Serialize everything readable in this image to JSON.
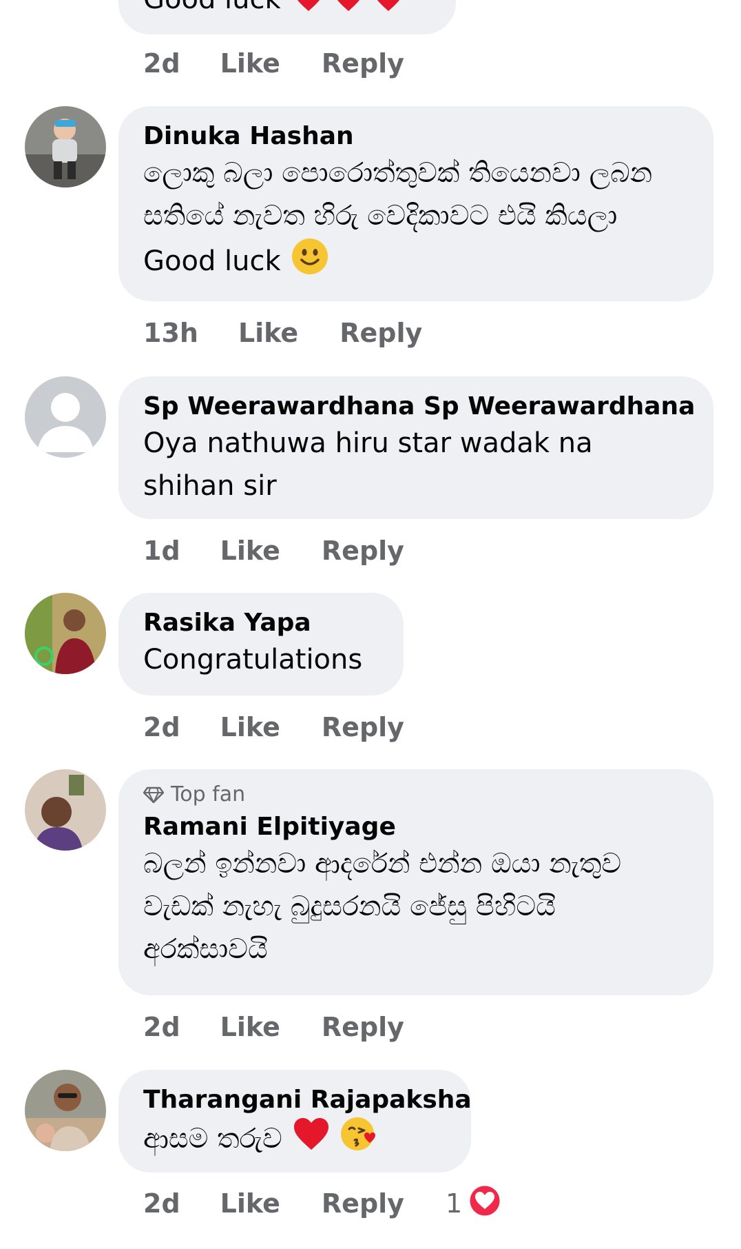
{
  "partial_comment": {
    "text": "Good luck",
    "time": "2d",
    "like_label": "Like",
    "reply_label": "Reply"
  },
  "comments": [
    {
      "author": "Dinuka Hashan",
      "text": "ලොකු බලා පොරොත්තුවක් තියෙනවා ලබන සතියේ නැවත හිරු වෙදිකාවට එයි කියලා Good luck",
      "time": "13h",
      "like_label": "Like",
      "reply_label": "Reply",
      "emoji": "slightly-smiling-face-icon"
    },
    {
      "author": "Sp Weerawardhana Sp Weerawardhana",
      "text": "Oya nathuwa hiru star wadak na shihan sir",
      "time": "1d",
      "like_label": "Like",
      "reply_label": "Reply"
    },
    {
      "author": "Rasika Yapa",
      "text": "Congratulations",
      "time": "2d",
      "like_label": "Like",
      "reply_label": "Reply"
    },
    {
      "badge": "Top fan",
      "author": "Ramani Elpitiyage",
      "text": "බලන් ඉන්නවා  ආදරේන් එන්න ඔයා  නැතුව  වැඩක් නැහැ බුදුසරනයි  ජේසු පිහිටයි අරක්සාවයි",
      "time": "2d",
      "like_label": "Like",
      "reply_label": "Reply"
    },
    {
      "author": "Tharangani Rajapaksha",
      "text": "ආසම තරුව",
      "time": "2d",
      "like_label": "Like",
      "reply_label": "Reply",
      "reaction_count": "1"
    }
  ],
  "colors": {
    "bubble": "#eff0f3",
    "meta": "#65676b",
    "text": "#050505",
    "heart": "#f02849"
  }
}
